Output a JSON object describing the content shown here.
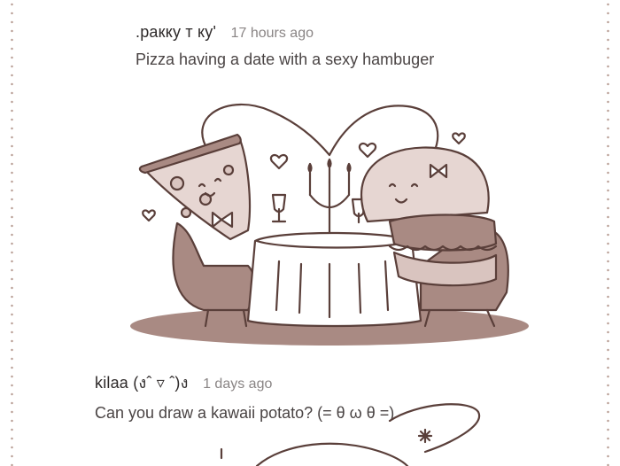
{
  "comments": [
    {
      "username": ".ракку т ку'",
      "timestamp": "17 hours ago",
      "text": "Pizza having a date with a sexy hambuger",
      "artwork": "pizza-and-hamburger-date-drawing"
    },
    {
      "username": "kilaa (งˆ ▿ ˆ)ง",
      "timestamp": "1 days ago",
      "text": "Can you draw a kawaii potato? (= θ ω θ =)",
      "artwork": "potato-drawing-partial"
    }
  ],
  "colors": {
    "ink": "#5a3f3a",
    "fill_light": "#d9c4bf",
    "fill_dark": "#a98a83",
    "border_dots": "#b89d94"
  }
}
